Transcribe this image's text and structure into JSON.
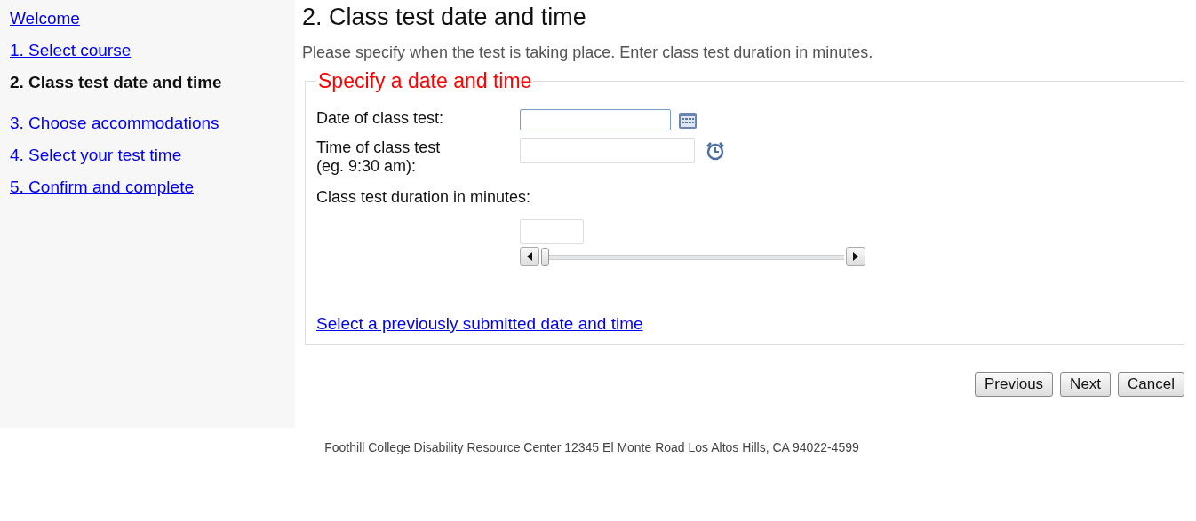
{
  "sidebar": {
    "items": [
      {
        "label": "Welcome",
        "selected": false
      },
      {
        "label": "1. Select course",
        "selected": false
      },
      {
        "label": "2. Class test date and time",
        "selected": true
      },
      {
        "label": "3. Choose accommodations",
        "selected": false
      },
      {
        "label": "4. Select your test time",
        "selected": false
      },
      {
        "label": "5. Confirm and complete",
        "selected": false
      }
    ]
  },
  "heading": "2. Class test date and time",
  "instructions": "Please specify when the test is taking place. Enter class test duration in minutes.",
  "fieldset": {
    "legend": "Specify a date and time",
    "date": {
      "label": "Date of class test:",
      "focused": true
    },
    "time": {
      "label_lines": [
        "Time of class test",
        "(eg. 9:30 am):"
      ],
      "focused": false
    },
    "duration": {
      "label": "Class test duration in minutes:",
      "level": 0
    },
    "link": "Select a previously submitted date and time"
  },
  "buttons": [
    "Previous",
    "Next",
    "Cancel"
  ],
  "footer": "Foothill College Disability Resource Center 12345 El Monte Road Los Altos Hills, CA 94022-4599"
}
